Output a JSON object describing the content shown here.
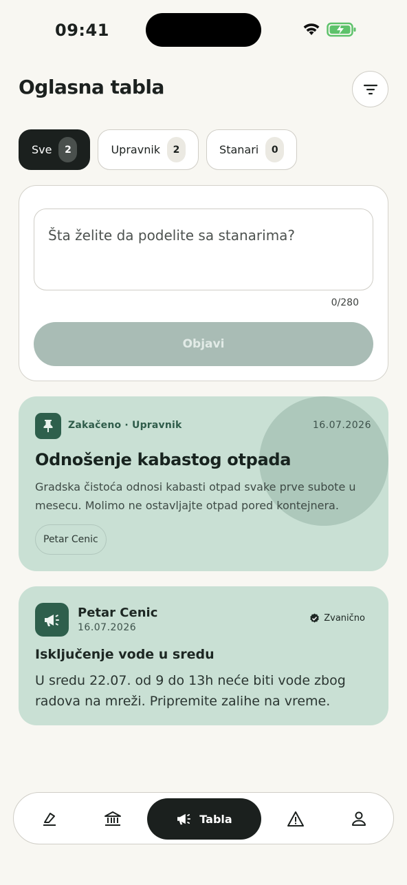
{
  "status_bar": {
    "time": "09:41"
  },
  "header": {
    "title": "Oglasna tabla",
    "filter_icon": "filter-icon"
  },
  "tabs": [
    {
      "label": "Sve",
      "count": "2",
      "active": true
    },
    {
      "label": "Upravnik",
      "count": "2",
      "active": false
    },
    {
      "label": "Stanari",
      "count": "0",
      "active": false
    }
  ],
  "composer": {
    "placeholder": "Šta želite da podelite sa stanarima?",
    "value": "",
    "char_count": "0/280",
    "publish_label": "Objavi"
  },
  "posts": [
    {
      "icon": "pin-icon",
      "meta": "Zakačeno · Upravnik",
      "date": "16.07.2026",
      "title": "Odnošenje kabastog otpada",
      "body": "Gradska čistoća odnosi kabasti otpad svake prve subote u mesecu. Molimo ne ostavljajte otpad pored kontejnera.",
      "author": "Petar Cenic"
    },
    {
      "icon": "megaphone-icon",
      "author": "Petar Cenic",
      "date": "16.07.2026",
      "badge": "Zvanično",
      "title": "Isključenje vode u sredu",
      "body": "U sredu 22.07. od 9 do 13h neće biti vode zbog radova na mreži. Pripremite zalihe na vreme."
    }
  ],
  "bottom_nav": {
    "items": [
      {
        "icon": "home-edit-icon"
      },
      {
        "icon": "bank-icon"
      },
      {
        "icon": "megaphone-icon",
        "label": "Tabla",
        "active": true
      },
      {
        "icon": "warning-icon"
      },
      {
        "icon": "profile-icon"
      }
    ]
  },
  "colors": {
    "accent": "#2e5f4c",
    "card_bg": "#c9e0d4",
    "dark": "#1b201e"
  }
}
